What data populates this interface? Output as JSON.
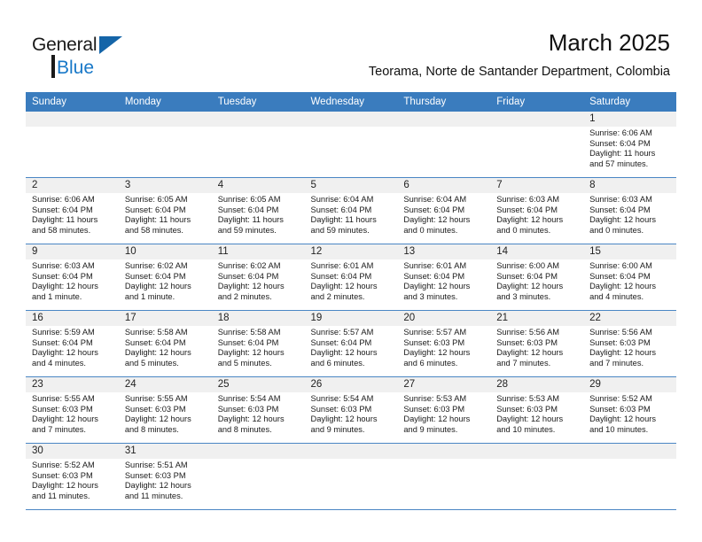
{
  "brand": {
    "line1": "General",
    "line2": "Blue",
    "triangle_icon": "brand-triangle-icon",
    "accent_color": "#1878c8",
    "dark_color": "#1a1a1a"
  },
  "header": {
    "title": "March 2025",
    "subtitle": "Teorama, Norte de Santander Department, Colombia"
  },
  "theme": {
    "header_blue": "#3a7cbe",
    "row_divider": "#4a86c4",
    "daynum_band": "#f0f0f0"
  },
  "weekday_headers": [
    "Sunday",
    "Monday",
    "Tuesday",
    "Wednesday",
    "Thursday",
    "Friday",
    "Saturday"
  ],
  "weeks": [
    [
      {
        "day": "",
        "empty": true,
        "sunrise": "",
        "sunset": "",
        "daylight1": "",
        "daylight2": ""
      },
      {
        "day": "",
        "empty": true,
        "sunrise": "",
        "sunset": "",
        "daylight1": "",
        "daylight2": ""
      },
      {
        "day": "",
        "empty": true,
        "sunrise": "",
        "sunset": "",
        "daylight1": "",
        "daylight2": ""
      },
      {
        "day": "",
        "empty": true,
        "sunrise": "",
        "sunset": "",
        "daylight1": "",
        "daylight2": ""
      },
      {
        "day": "",
        "empty": true,
        "sunrise": "",
        "sunset": "",
        "daylight1": "",
        "daylight2": ""
      },
      {
        "day": "",
        "empty": true,
        "sunrise": "",
        "sunset": "",
        "daylight1": "",
        "daylight2": ""
      },
      {
        "day": "1",
        "empty": false,
        "sunrise": "Sunrise: 6:06 AM",
        "sunset": "Sunset: 6:04 PM",
        "daylight1": "Daylight: 11 hours",
        "daylight2": "and 57 minutes."
      }
    ],
    [
      {
        "day": "2",
        "empty": false,
        "sunrise": "Sunrise: 6:06 AM",
        "sunset": "Sunset: 6:04 PM",
        "daylight1": "Daylight: 11 hours",
        "daylight2": "and 58 minutes."
      },
      {
        "day": "3",
        "empty": false,
        "sunrise": "Sunrise: 6:05 AM",
        "sunset": "Sunset: 6:04 PM",
        "daylight1": "Daylight: 11 hours",
        "daylight2": "and 58 minutes."
      },
      {
        "day": "4",
        "empty": false,
        "sunrise": "Sunrise: 6:05 AM",
        "sunset": "Sunset: 6:04 PM",
        "daylight1": "Daylight: 11 hours",
        "daylight2": "and 59 minutes."
      },
      {
        "day": "5",
        "empty": false,
        "sunrise": "Sunrise: 6:04 AM",
        "sunset": "Sunset: 6:04 PM",
        "daylight1": "Daylight: 11 hours",
        "daylight2": "and 59 minutes."
      },
      {
        "day": "6",
        "empty": false,
        "sunrise": "Sunrise: 6:04 AM",
        "sunset": "Sunset: 6:04 PM",
        "daylight1": "Daylight: 12 hours",
        "daylight2": "and 0 minutes."
      },
      {
        "day": "7",
        "empty": false,
        "sunrise": "Sunrise: 6:03 AM",
        "sunset": "Sunset: 6:04 PM",
        "daylight1": "Daylight: 12 hours",
        "daylight2": "and 0 minutes."
      },
      {
        "day": "8",
        "empty": false,
        "sunrise": "Sunrise: 6:03 AM",
        "sunset": "Sunset: 6:04 PM",
        "daylight1": "Daylight: 12 hours",
        "daylight2": "and 0 minutes."
      }
    ],
    [
      {
        "day": "9",
        "empty": false,
        "sunrise": "Sunrise: 6:03 AM",
        "sunset": "Sunset: 6:04 PM",
        "daylight1": "Daylight: 12 hours",
        "daylight2": "and 1 minute."
      },
      {
        "day": "10",
        "empty": false,
        "sunrise": "Sunrise: 6:02 AM",
        "sunset": "Sunset: 6:04 PM",
        "daylight1": "Daylight: 12 hours",
        "daylight2": "and 1 minute."
      },
      {
        "day": "11",
        "empty": false,
        "sunrise": "Sunrise: 6:02 AM",
        "sunset": "Sunset: 6:04 PM",
        "daylight1": "Daylight: 12 hours",
        "daylight2": "and 2 minutes."
      },
      {
        "day": "12",
        "empty": false,
        "sunrise": "Sunrise: 6:01 AM",
        "sunset": "Sunset: 6:04 PM",
        "daylight1": "Daylight: 12 hours",
        "daylight2": "and 2 minutes."
      },
      {
        "day": "13",
        "empty": false,
        "sunrise": "Sunrise: 6:01 AM",
        "sunset": "Sunset: 6:04 PM",
        "daylight1": "Daylight: 12 hours",
        "daylight2": "and 3 minutes."
      },
      {
        "day": "14",
        "empty": false,
        "sunrise": "Sunrise: 6:00 AM",
        "sunset": "Sunset: 6:04 PM",
        "daylight1": "Daylight: 12 hours",
        "daylight2": "and 3 minutes."
      },
      {
        "day": "15",
        "empty": false,
        "sunrise": "Sunrise: 6:00 AM",
        "sunset": "Sunset: 6:04 PM",
        "daylight1": "Daylight: 12 hours",
        "daylight2": "and 4 minutes."
      }
    ],
    [
      {
        "day": "16",
        "empty": false,
        "sunrise": "Sunrise: 5:59 AM",
        "sunset": "Sunset: 6:04 PM",
        "daylight1": "Daylight: 12 hours",
        "daylight2": "and 4 minutes."
      },
      {
        "day": "17",
        "empty": false,
        "sunrise": "Sunrise: 5:58 AM",
        "sunset": "Sunset: 6:04 PM",
        "daylight1": "Daylight: 12 hours",
        "daylight2": "and 5 minutes."
      },
      {
        "day": "18",
        "empty": false,
        "sunrise": "Sunrise: 5:58 AM",
        "sunset": "Sunset: 6:04 PM",
        "daylight1": "Daylight: 12 hours",
        "daylight2": "and 5 minutes."
      },
      {
        "day": "19",
        "empty": false,
        "sunrise": "Sunrise: 5:57 AM",
        "sunset": "Sunset: 6:04 PM",
        "daylight1": "Daylight: 12 hours",
        "daylight2": "and 6 minutes."
      },
      {
        "day": "20",
        "empty": false,
        "sunrise": "Sunrise: 5:57 AM",
        "sunset": "Sunset: 6:03 PM",
        "daylight1": "Daylight: 12 hours",
        "daylight2": "and 6 minutes."
      },
      {
        "day": "21",
        "empty": false,
        "sunrise": "Sunrise: 5:56 AM",
        "sunset": "Sunset: 6:03 PM",
        "daylight1": "Daylight: 12 hours",
        "daylight2": "and 7 minutes."
      },
      {
        "day": "22",
        "empty": false,
        "sunrise": "Sunrise: 5:56 AM",
        "sunset": "Sunset: 6:03 PM",
        "daylight1": "Daylight: 12 hours",
        "daylight2": "and 7 minutes."
      }
    ],
    [
      {
        "day": "23",
        "empty": false,
        "sunrise": "Sunrise: 5:55 AM",
        "sunset": "Sunset: 6:03 PM",
        "daylight1": "Daylight: 12 hours",
        "daylight2": "and 7 minutes."
      },
      {
        "day": "24",
        "empty": false,
        "sunrise": "Sunrise: 5:55 AM",
        "sunset": "Sunset: 6:03 PM",
        "daylight1": "Daylight: 12 hours",
        "daylight2": "and 8 minutes."
      },
      {
        "day": "25",
        "empty": false,
        "sunrise": "Sunrise: 5:54 AM",
        "sunset": "Sunset: 6:03 PM",
        "daylight1": "Daylight: 12 hours",
        "daylight2": "and 8 minutes."
      },
      {
        "day": "26",
        "empty": false,
        "sunrise": "Sunrise: 5:54 AM",
        "sunset": "Sunset: 6:03 PM",
        "daylight1": "Daylight: 12 hours",
        "daylight2": "and 9 minutes."
      },
      {
        "day": "27",
        "empty": false,
        "sunrise": "Sunrise: 5:53 AM",
        "sunset": "Sunset: 6:03 PM",
        "daylight1": "Daylight: 12 hours",
        "daylight2": "and 9 minutes."
      },
      {
        "day": "28",
        "empty": false,
        "sunrise": "Sunrise: 5:53 AM",
        "sunset": "Sunset: 6:03 PM",
        "daylight1": "Daylight: 12 hours",
        "daylight2": "and 10 minutes."
      },
      {
        "day": "29",
        "empty": false,
        "sunrise": "Sunrise: 5:52 AM",
        "sunset": "Sunset: 6:03 PM",
        "daylight1": "Daylight: 12 hours",
        "daylight2": "and 10 minutes."
      }
    ],
    [
      {
        "day": "30",
        "empty": false,
        "sunrise": "Sunrise: 5:52 AM",
        "sunset": "Sunset: 6:03 PM",
        "daylight1": "Daylight: 12 hours",
        "daylight2": "and 11 minutes."
      },
      {
        "day": "31",
        "empty": false,
        "sunrise": "Sunrise: 5:51 AM",
        "sunset": "Sunset: 6:03 PM",
        "daylight1": "Daylight: 12 hours",
        "daylight2": "and 11 minutes."
      },
      {
        "day": "",
        "empty": true,
        "sunrise": "",
        "sunset": "",
        "daylight1": "",
        "daylight2": ""
      },
      {
        "day": "",
        "empty": true,
        "sunrise": "",
        "sunset": "",
        "daylight1": "",
        "daylight2": ""
      },
      {
        "day": "",
        "empty": true,
        "sunrise": "",
        "sunset": "",
        "daylight1": "",
        "daylight2": ""
      },
      {
        "day": "",
        "empty": true,
        "sunrise": "",
        "sunset": "",
        "daylight1": "",
        "daylight2": ""
      },
      {
        "day": "",
        "empty": true,
        "sunrise": "",
        "sunset": "",
        "daylight1": "",
        "daylight2": ""
      }
    ]
  ]
}
